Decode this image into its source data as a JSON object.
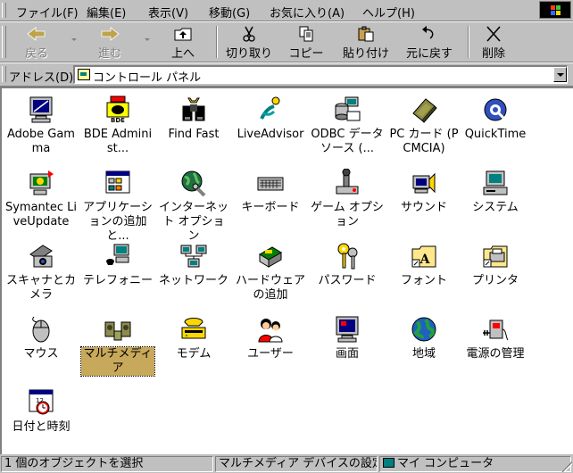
{
  "menu": [
    {
      "label": "ファイル(F)"
    },
    {
      "label": "編集(E)"
    },
    {
      "label": "表示(V)"
    },
    {
      "label": "移動(G)"
    },
    {
      "label": "お気に入り(A)"
    },
    {
      "label": "ヘルプ(H)"
    }
  ],
  "toolbar": {
    "back": "戻る",
    "forward": "進む",
    "up": "上へ",
    "cut": "切り取り",
    "copy": "コピー",
    "paste": "貼り付け",
    "undo": "元に戻す",
    "delete": "削除"
  },
  "address": {
    "label": "アドレス(D)",
    "value": "コントロール パネル"
  },
  "items": [
    {
      "label": "Adobe Gamma",
      "icon": "monitor-gamma-icon"
    },
    {
      "label": "BDE Administ...",
      "icon": "bde-admin-icon"
    },
    {
      "label": "Find Fast",
      "icon": "binoculars-icon"
    },
    {
      "label": "LiveAdvisor",
      "icon": "live-advisor-icon"
    },
    {
      "label": "ODBC データ ソース (...",
      "icon": "odbc-icon"
    },
    {
      "label": "PC カード (PCMCIA)",
      "icon": "pc-card-icon"
    },
    {
      "label": "QuickTime",
      "icon": "quicktime-icon"
    },
    {
      "label": "Symantec LiveUpdate",
      "icon": "liveupdate-icon"
    },
    {
      "label": "アプリケーションの追加と...",
      "icon": "add-remove-programs-icon"
    },
    {
      "label": "インターネット オプション",
      "icon": "internet-options-icon"
    },
    {
      "label": "キーボード",
      "icon": "keyboard-icon"
    },
    {
      "label": "ゲーム オプション",
      "icon": "joystick-icon"
    },
    {
      "label": "サウンド",
      "icon": "speaker-icon"
    },
    {
      "label": "システム",
      "icon": "computer-icon"
    },
    {
      "label": "スキャナとカメラ",
      "icon": "scanner-icon"
    },
    {
      "label": "テレフォニー",
      "icon": "telephony-icon"
    },
    {
      "label": "ネットワーク",
      "icon": "network-icon"
    },
    {
      "label": "ハードウェアの追加",
      "icon": "add-hardware-icon"
    },
    {
      "label": "パスワード",
      "icon": "keys-icon"
    },
    {
      "label": "フォント",
      "icon": "fonts-folder-icon"
    },
    {
      "label": "プリンタ",
      "icon": "printers-folder-icon"
    },
    {
      "label": "マウス",
      "icon": "mouse-icon"
    },
    {
      "label": "マルチメディア",
      "icon": "multimedia-icon",
      "selected": true
    },
    {
      "label": "モデム",
      "icon": "modem-icon"
    },
    {
      "label": "ユーザー",
      "icon": "users-icon"
    },
    {
      "label": "画面",
      "icon": "display-icon"
    },
    {
      "label": "地域",
      "icon": "globe-icon"
    },
    {
      "label": "電源の管理",
      "icon": "power-icon"
    },
    {
      "label": "日付と時刻",
      "icon": "calendar-clock-icon"
    }
  ],
  "status": {
    "selection": "1 個のオブジェクトを選択",
    "description": "マルチメディア デバイスの設定を変更します。",
    "location": "マイ コンピュータ"
  }
}
